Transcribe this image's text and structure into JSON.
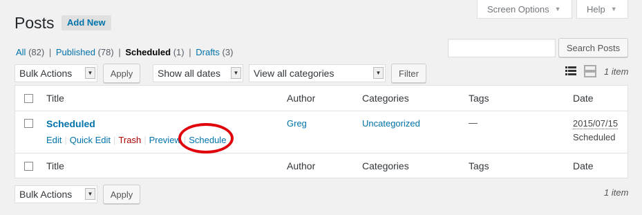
{
  "screen_options": {
    "label": "Screen Options"
  },
  "help": {
    "label": "Help"
  },
  "page": {
    "title": "Posts",
    "add_new": "Add New"
  },
  "views": {
    "all": {
      "label": "All",
      "count": "(82)"
    },
    "published": {
      "label": "Published",
      "count": "(78)"
    },
    "scheduled": {
      "label": "Scheduled",
      "count": "(1)"
    },
    "drafts": {
      "label": "Drafts",
      "count": "(3)"
    },
    "separator": "|"
  },
  "search": {
    "value": "",
    "button": "Search Posts"
  },
  "top_nav": {
    "bulk_actions": "Bulk Actions",
    "apply": "Apply",
    "dates": "Show all dates",
    "categories": "View all categories",
    "filter": "Filter",
    "items_count": "1 item"
  },
  "columns": {
    "title": "Title",
    "author": "Author",
    "categories": "Categories",
    "tags": "Tags",
    "date": "Date"
  },
  "posts": [
    {
      "title": "Scheduled",
      "author": "Greg",
      "categories": "Uncategorized",
      "tags": "—",
      "date": "2015/07/15",
      "status": "Scheduled",
      "actions": {
        "edit": "Edit",
        "quick_edit": "Quick Edit",
        "trash": "Trash",
        "preview": "Preview",
        "schedule": "Schedule"
      }
    }
  ],
  "bottom_nav": {
    "bulk_actions": "Bulk Actions",
    "apply": "Apply",
    "items_count": "1 item"
  },
  "colors": {
    "link": "#0073aa",
    "trash": "#a00",
    "highlight_oval": "#e0000a",
    "background": "#f1f1f1"
  },
  "icons": {
    "list_view": "list-view-icon",
    "excerpt_view": "excerpt-view-icon",
    "dropdown": "chevron-down-icon"
  }
}
